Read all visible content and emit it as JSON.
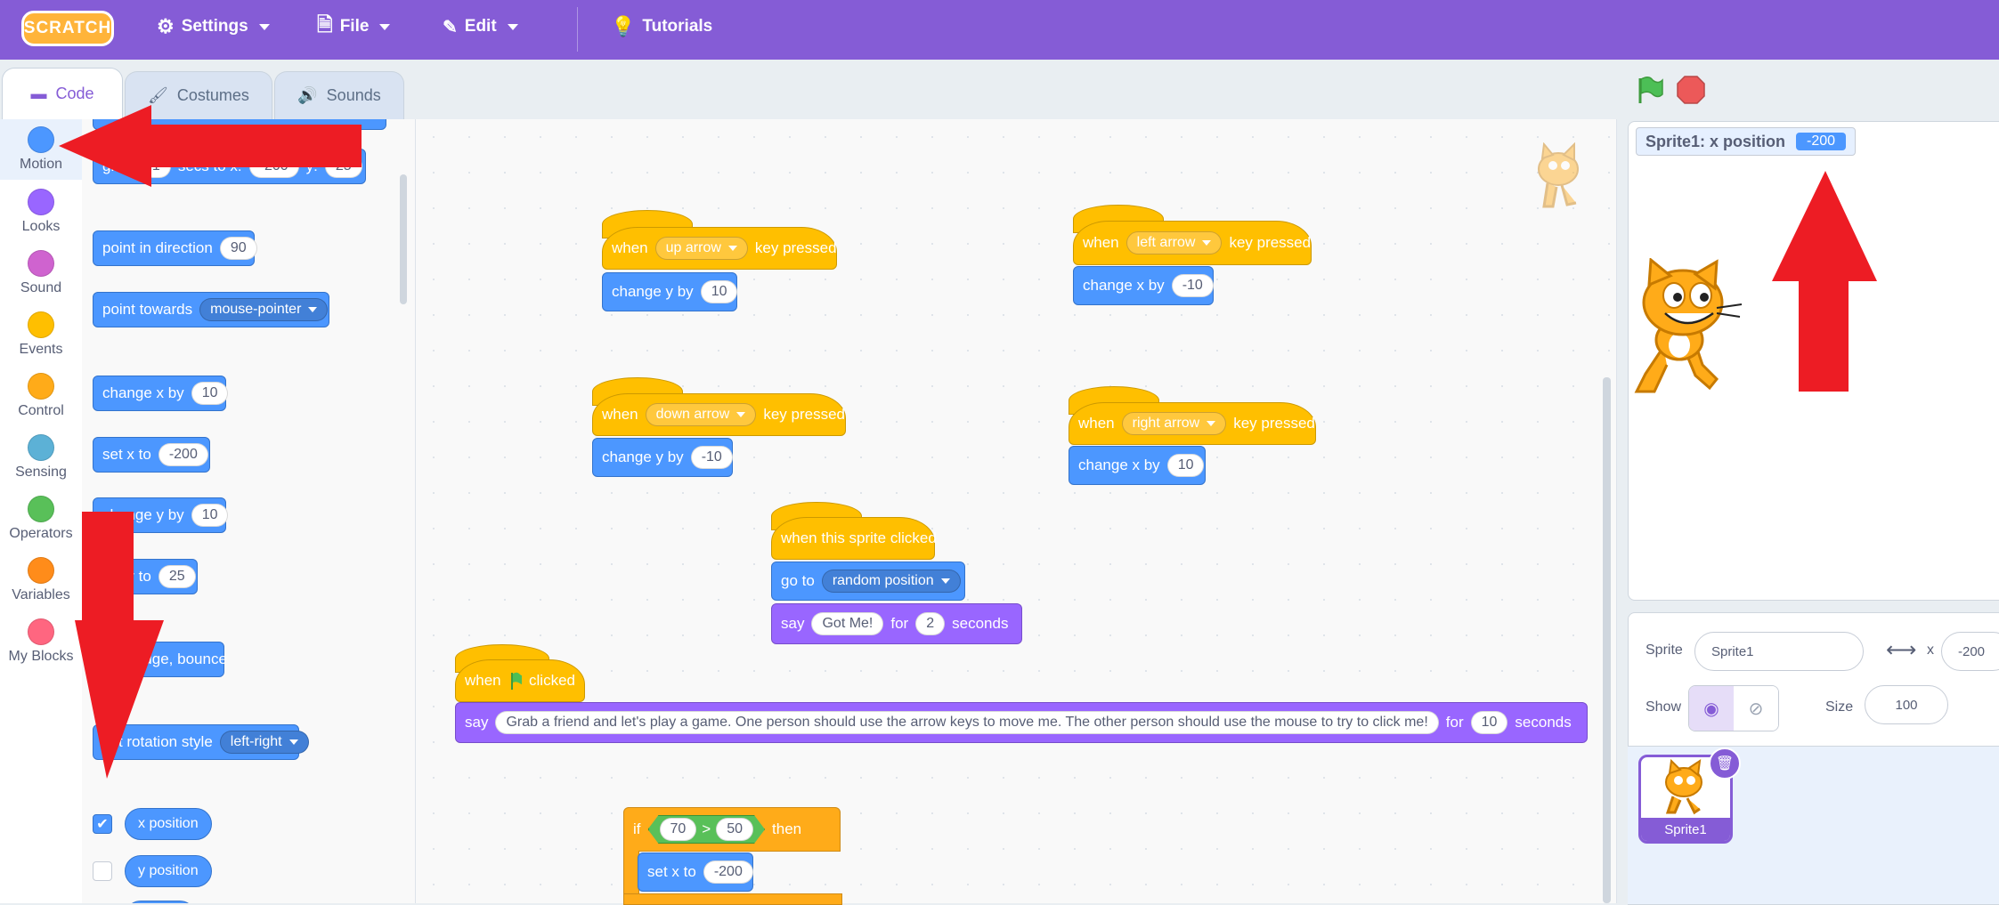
{
  "menu": {
    "logo": "SCRATCH",
    "settings": "Settings",
    "file": "File",
    "edit": "Edit",
    "tutorials": "Tutorials"
  },
  "tabs": {
    "code": "Code",
    "costumes": "Costumes",
    "sounds": "Sounds"
  },
  "categories": [
    {
      "label": "Motion",
      "color": "#4c97ff"
    },
    {
      "label": "Looks",
      "color": "#9966ff"
    },
    {
      "label": "Sound",
      "color": "#cf63cf"
    },
    {
      "label": "Events",
      "color": "#ffbf00"
    },
    {
      "label": "Control",
      "color": "#ffab19"
    },
    {
      "label": "Sensing",
      "color": "#5cb1d6"
    },
    {
      "label": "Operators",
      "color": "#59c059"
    },
    {
      "label": "Variables",
      "color": "#ff8c1a"
    },
    {
      "label": "My Blocks",
      "color": "#ff6680"
    }
  ],
  "palette": {
    "glide": {
      "a": "glide",
      "secs": "1",
      "b": "secs to x:",
      "x": "-200",
      "c": "y:",
      "y": "25"
    },
    "point_dir": {
      "text": "point in direction",
      "val": "90"
    },
    "point_towards": {
      "text": "point towards",
      "val": "mouse-pointer"
    },
    "change_x": {
      "text": "change x by",
      "val": "10"
    },
    "set_x": {
      "text": "set x to",
      "val": "-200"
    },
    "change_y": {
      "text": "change y by",
      "val": "10"
    },
    "set_y": {
      "text": "set y to",
      "val": "25"
    },
    "bounce": {
      "text": "if on edge, bounce"
    },
    "rotation": {
      "text": "set rotation style",
      "val": "left-right"
    },
    "x_position": "x position",
    "y_position": "y position"
  },
  "scripts": {
    "up": {
      "when": "when",
      "key": "up arrow",
      "pressed": "key pressed",
      "action": "change y by",
      "val": "10"
    },
    "left": {
      "when": "when",
      "key": "left arrow",
      "pressed": "key pressed",
      "action": "change x by",
      "val": "-10"
    },
    "down": {
      "when": "when",
      "key": "down arrow",
      "pressed": "key pressed",
      "action": "change y by",
      "val": "-10"
    },
    "right": {
      "when": "when",
      "key": "right arrow",
      "pressed": "key pressed",
      "action": "change x by",
      "val": "10"
    },
    "clicked": {
      "hat": "when this sprite clicked",
      "goto": "go to",
      "goto_val": "random position",
      "say": "say",
      "say_val": "Got Me!",
      "for": "for",
      "secs": "2",
      "seconds": "seconds"
    },
    "flag": {
      "when": "when",
      "clicked": "clicked",
      "say": "say",
      "msg": "Grab a friend and let's play a game. One person should use the arrow keys to move me. The other person should use the mouse to try to click me!",
      "for": "for",
      "secs": "10",
      "seconds": "seconds"
    },
    "if": {
      "if": "if",
      "a": "70",
      "op": ">",
      "b": "50",
      "then": "then",
      "action": "set x to",
      "val": "-200"
    }
  },
  "stage": {
    "monitor_label": "Sprite1: x position",
    "monitor_value": "-200"
  },
  "sprite_info": {
    "sprite_label": "Sprite",
    "sprite_name": "Sprite1",
    "x_label": "x",
    "x_value": "-200",
    "show_label": "Show",
    "size_label": "Size",
    "size_value": "100"
  },
  "sprite_list": [
    {
      "name": "Sprite1"
    }
  ]
}
